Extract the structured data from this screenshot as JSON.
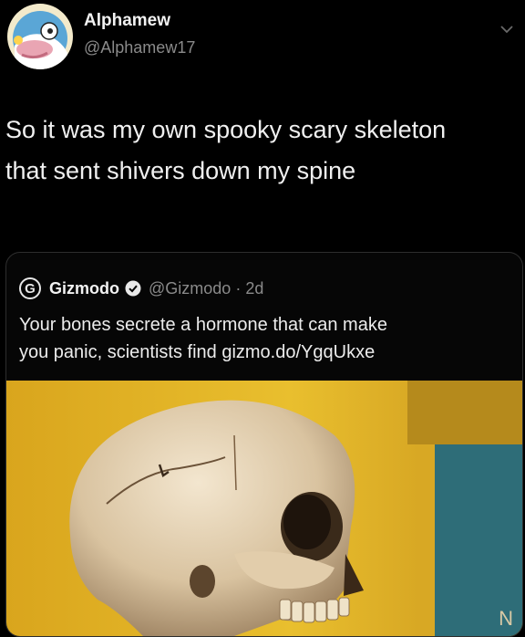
{
  "tweet": {
    "display_name": "Alphamew",
    "handle": "@Alphamew17",
    "text_line1": "So it was my own spooky scary skeleton",
    "text_line2": "that sent shivers down my spine"
  },
  "quote": {
    "name": "Gizmodo",
    "handle": "@Gizmodo",
    "separator": "·",
    "age": "2d",
    "text_line1": "Your bones secrete a hormone that can make",
    "text_line2": "you panic, scientists find gizmo.do/YgqUkxe",
    "logo_letter": "G"
  },
  "colors": {
    "background": "#000000",
    "muted_text": "#8a8a8a",
    "card_border": "#2e2e2e",
    "wall_yellow": "#e2b422",
    "wall_teal": "#2e6d78"
  },
  "icons": {
    "avatar": "cartoon-bird-avatar",
    "menu": "chevron-down-icon",
    "verified": "verified-badge-icon",
    "logo": "gizmodo-logo"
  }
}
